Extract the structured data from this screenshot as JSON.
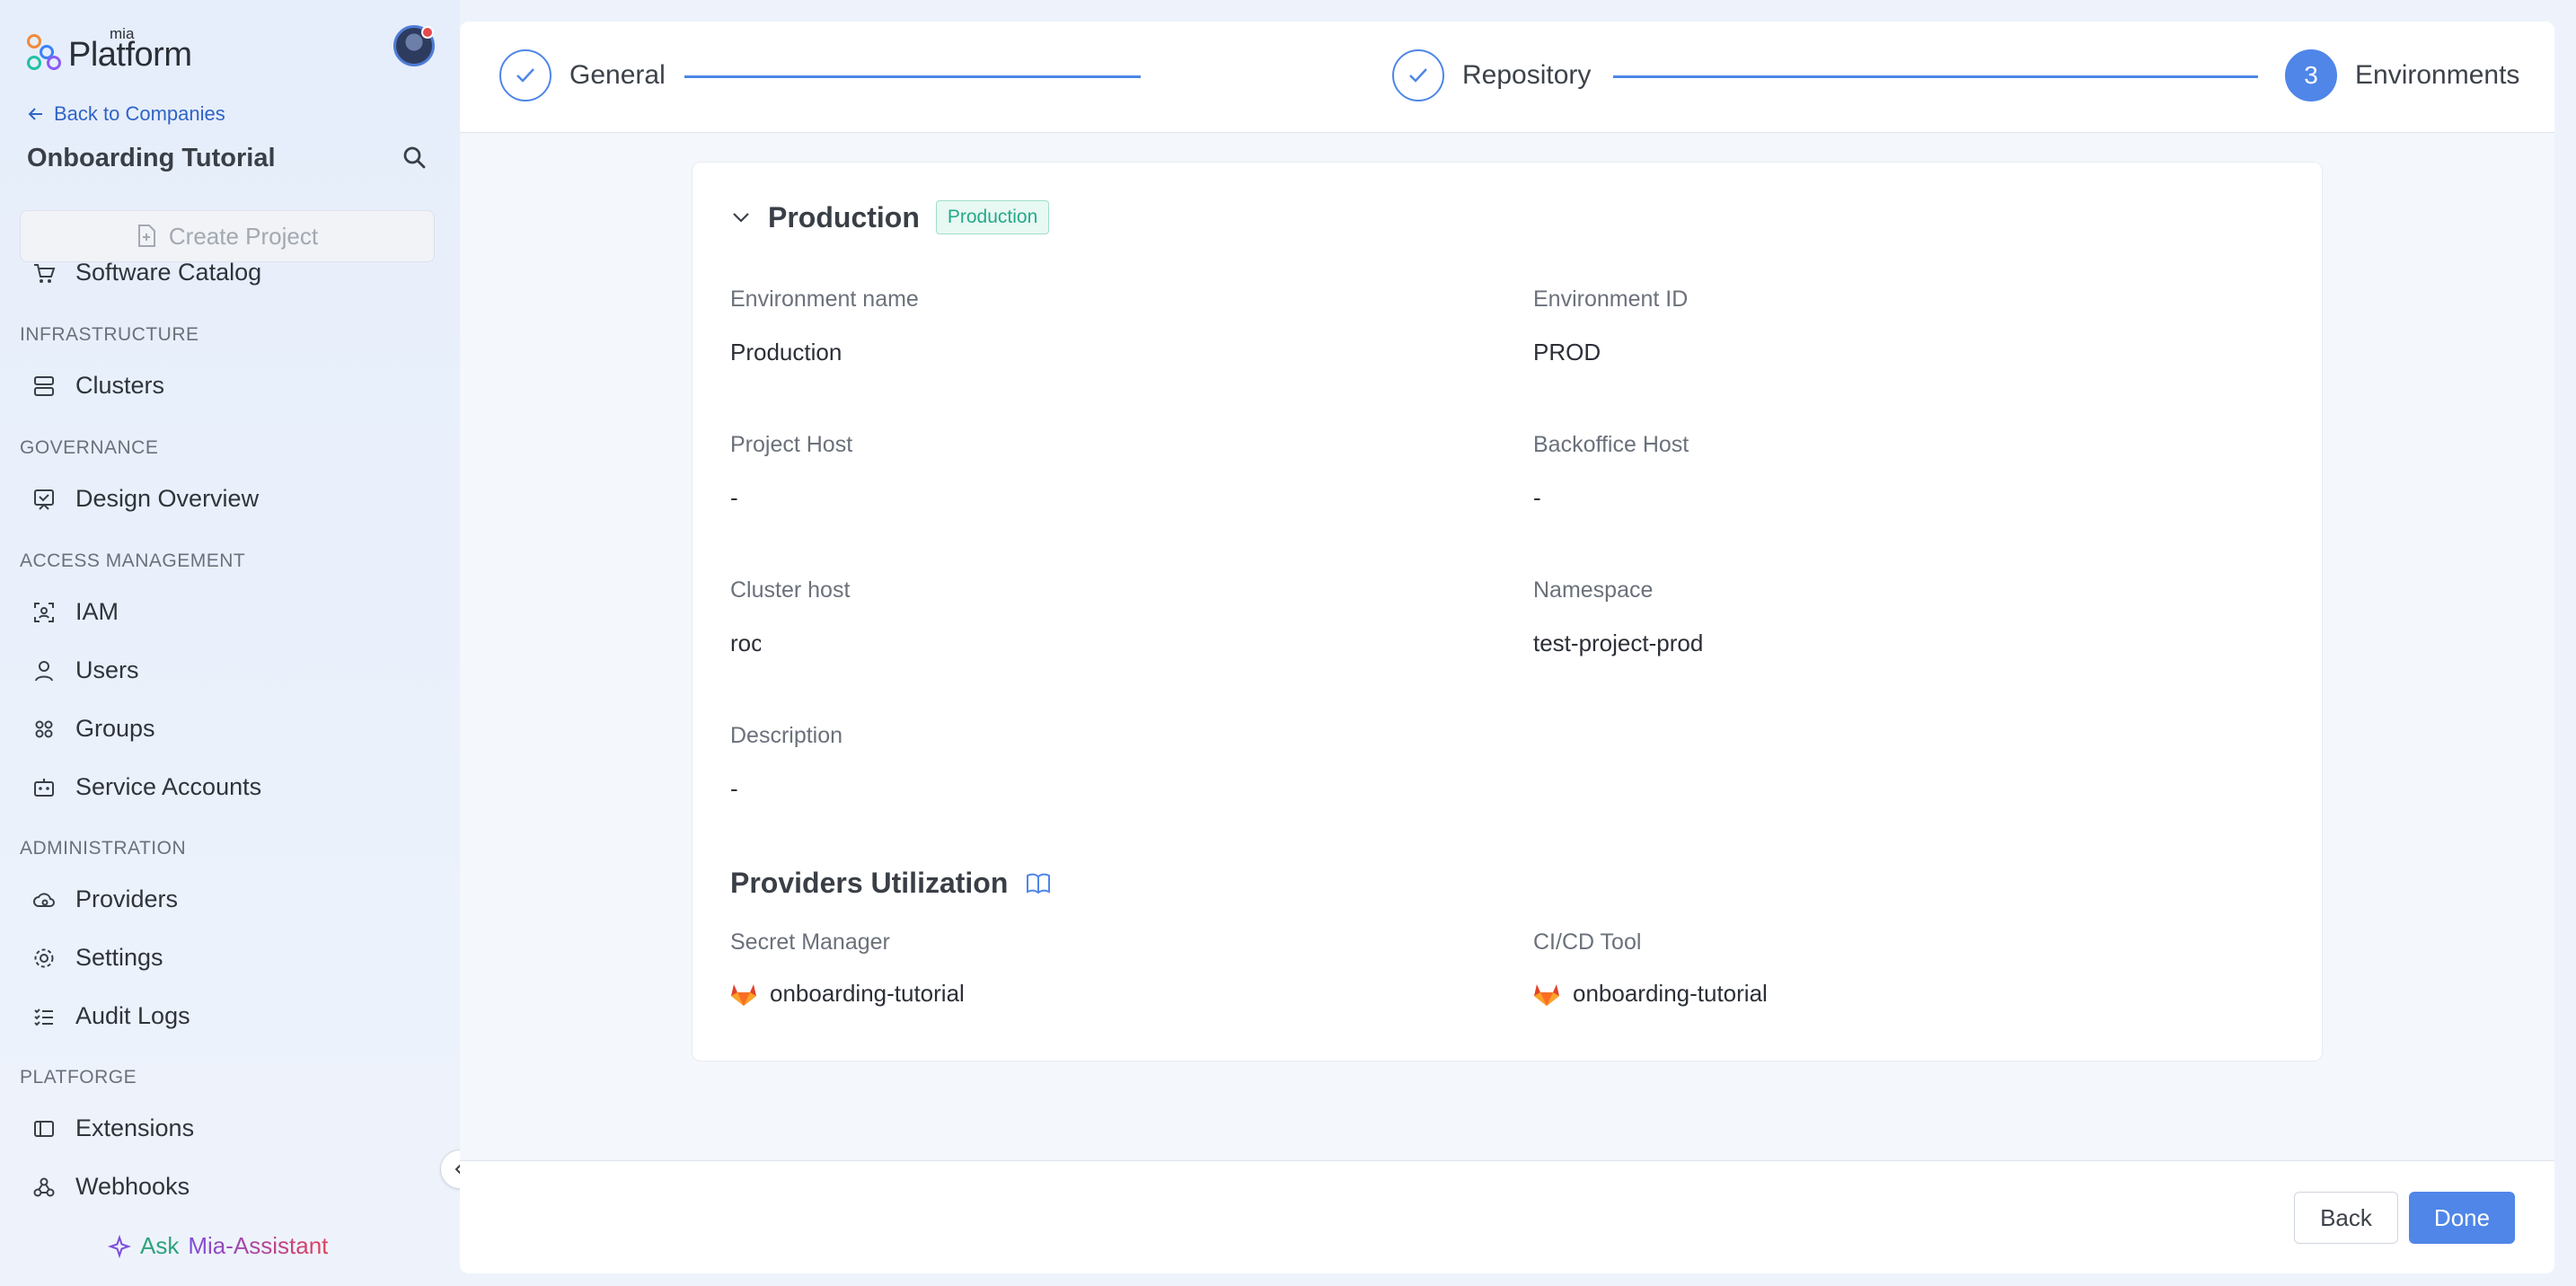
{
  "brand": {
    "small": "mia",
    "big": "Platform"
  },
  "sidebar": {
    "back_label": "Back to Companies",
    "company": "Onboarding Tutorial",
    "create_project": "Create Project",
    "software_catalog": "Software Catalog",
    "sections": {
      "infrastructure": "INFRASTRUCTURE",
      "governance": "GOVERNANCE",
      "access": "ACCESS MANAGEMENT",
      "administration": "ADMINISTRATION",
      "platforge": "PLATFORGE"
    },
    "items": {
      "clusters": "Clusters",
      "design_overview": "Design Overview",
      "iam": "IAM",
      "users": "Users",
      "groups": "Groups",
      "service_accounts": "Service Accounts",
      "providers": "Providers",
      "settings": "Settings",
      "audit_logs": "Audit Logs",
      "extensions": "Extensions",
      "webhooks": "Webhooks"
    },
    "assistant": {
      "ask": "Ask",
      "name": "Mia-Assistant"
    }
  },
  "stepper": {
    "steps": [
      {
        "label": "General",
        "state": "done"
      },
      {
        "label": "Repository",
        "state": "done"
      },
      {
        "label": "Environments",
        "state": "active",
        "number": "3"
      }
    ]
  },
  "environment": {
    "title": "Production",
    "tag": "Production",
    "fields": {
      "env_name_label": "Environment name",
      "env_name_value": "Production",
      "env_id_label": "Environment ID",
      "env_id_value": "PROD",
      "project_host_label": "Project Host",
      "project_host_value": "-",
      "backoffice_host_label": "Backoffice Host",
      "backoffice_host_value": "-",
      "cluster_host_label": "Cluster host",
      "cluster_host_value": "roc",
      "namespace_label": "Namespace",
      "namespace_value": "test-project-prod",
      "description_label": "Description",
      "description_value": "-"
    },
    "providers": {
      "title": "Providers Utilization",
      "secret_manager_label": "Secret Manager",
      "secret_manager_value": "onboarding-tutorial",
      "cicd_label": "CI/CD Tool",
      "cicd_value": "onboarding-tutorial"
    }
  },
  "footer": {
    "back": "Back",
    "done": "Done"
  },
  "colors": {
    "accent": "#4f86e8",
    "tag_green": "#25a98a",
    "link": "#2f64c7"
  }
}
